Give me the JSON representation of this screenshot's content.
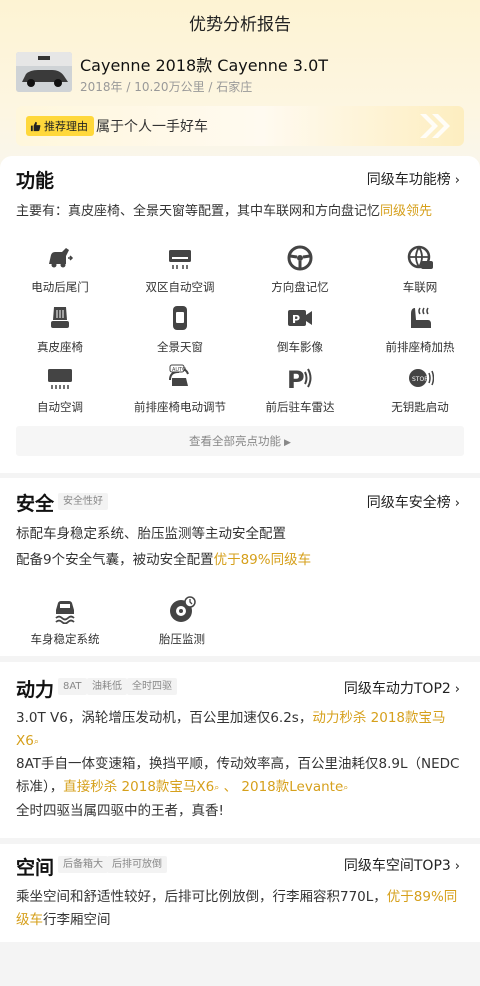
{
  "header": {
    "title": "优势分析报告"
  },
  "car": {
    "name": "Cayenne 2018款 Cayenne 3.0T",
    "meta": "2018年 / 10.20万公里 / 石家庄"
  },
  "reason": {
    "badge": "推荐理由",
    "text": "属于个人一手好车"
  },
  "function": {
    "title": "功能",
    "link": "同级车功能榜",
    "summary_prefix": "主要有：真皮座椅、全景天窗等配置，其中车联网和方向盘记忆",
    "summary_highlight": "同级领先",
    "features": [
      {
        "label": "电动后尾门",
        "icon": "power-tailgate-icon"
      },
      {
        "label": "双区自动空调",
        "icon": "dual-zone-ac-icon"
      },
      {
        "label": "方向盘记忆",
        "icon": "steering-wheel-icon"
      },
      {
        "label": "车联网",
        "icon": "connected-car-icon"
      },
      {
        "label": "真皮座椅",
        "icon": "leather-seat-icon"
      },
      {
        "label": "全景天窗",
        "icon": "panoramic-sunroof-icon"
      },
      {
        "label": "倒车影像",
        "icon": "reverse-camera-icon"
      },
      {
        "label": "前排座椅加热",
        "icon": "seat-heating-icon"
      },
      {
        "label": "自动空调",
        "icon": "auto-ac-icon"
      },
      {
        "label": "前排座椅电动调节",
        "icon": "power-seat-icon"
      },
      {
        "label": "前后驻车雷达",
        "icon": "parking-radar-icon"
      },
      {
        "label": "无钥匙启动",
        "icon": "keyless-start-icon"
      }
    ],
    "more": "查看全部亮点功能"
  },
  "safety": {
    "title": "安全",
    "tag": "安全性好",
    "link": "同级车安全榜",
    "line1": "标配车身稳定系统、胎压监测等主动安全配置",
    "line2_prefix": "配备9个安全气囊，被动安全配置",
    "line2_highlight": "优于89%同级车",
    "features": [
      {
        "label": "车身稳定系统",
        "icon": "stability-control-icon"
      },
      {
        "label": "胎压监测",
        "icon": "tire-pressure-icon"
      }
    ]
  },
  "power": {
    "title": "动力",
    "tags": [
      "8AT",
      "油耗低",
      "全时四驱"
    ],
    "link": "同级车动力TOP2",
    "p1_prefix": "3.0T V6，涡轮增压发动机，百公里加速仅6.2s，",
    "p1_hl1": "动力秒杀",
    "p1_hl2": "2018款宝马X6",
    "p2_text": "8AT手自一体变速箱，换挡平顺，传动效率高，百公里油耗仅8.9L（NEDC标准），",
    "p2_hl1": "直接秒杀",
    "p2_hl2": "2018款宝马X6",
    "p2_sep": "、",
    "p2_hl3": "2018款Levante",
    "p3": "全时四驱当属四驱中的王者，真香!"
  },
  "space": {
    "title": "空间",
    "tags": [
      "后备箱大",
      "后排可放倒"
    ],
    "link": "同级车空间TOP3",
    "text_prefix": "乘坐空间和舒适性较好，后排可比例放倒，行李厢容积770L，",
    "text_highlight": "优于89%同级车",
    "text_suffix": "行李厢空间"
  },
  "colors": {
    "accent": "#d6a01c",
    "badge": "#ffd83b"
  }
}
